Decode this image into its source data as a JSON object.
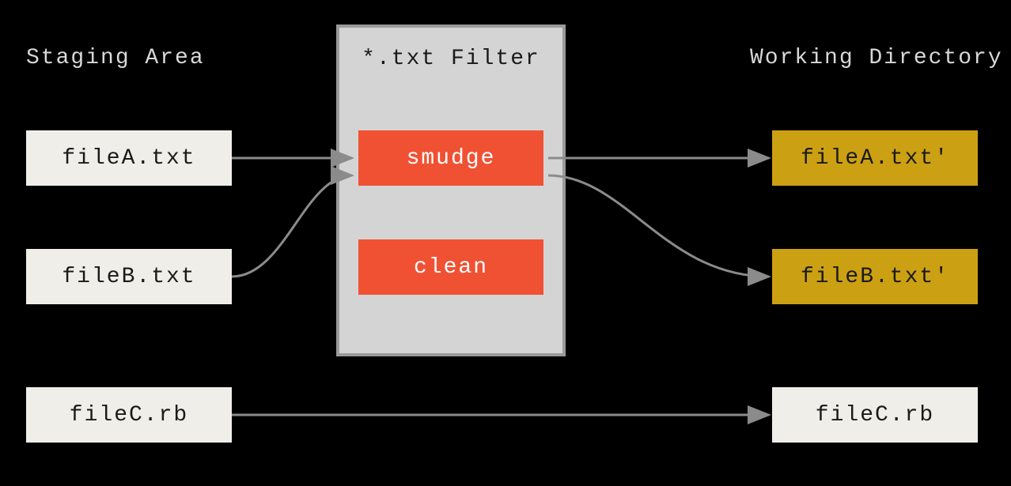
{
  "headings": {
    "staging": "Staging Area",
    "filter": "*.txt Filter",
    "working": "Working Directory"
  },
  "staging_files": {
    "a": "fileA.txt",
    "b": "fileB.txt",
    "c": "fileC.rb"
  },
  "filter_ops": {
    "smudge": "smudge",
    "clean": "clean"
  },
  "working_files": {
    "a": "fileA.txt'",
    "b": "fileB.txt'",
    "c": "fileC.rb"
  },
  "colors": {
    "background": "#000000",
    "heading_text": "#d8d8d8",
    "staging_box_bg": "#efeee8",
    "filter_container_bg": "#d4d4d4",
    "filter_container_border": "#9a9a9a",
    "filter_box_bg": "#f05133",
    "filter_box_text": "#ffffff",
    "wd_box_bg": "#cca013",
    "arrow": "#8b8b8b"
  },
  "diagram": {
    "description": "Git smudge/clean filter flow: staged .txt files pass through smudge on checkout into the working directory; .rb files bypass the filter.",
    "edges": [
      {
        "from": "fileA.txt (staging)",
        "to": "smudge"
      },
      {
        "from": "fileB.txt (staging)",
        "to": "smudge"
      },
      {
        "from": "smudge",
        "to": "fileA.txt' (working)"
      },
      {
        "from": "smudge",
        "to": "fileB.txt' (working)"
      },
      {
        "from": "fileC.rb (staging)",
        "to": "fileC.rb (working)"
      }
    ]
  }
}
